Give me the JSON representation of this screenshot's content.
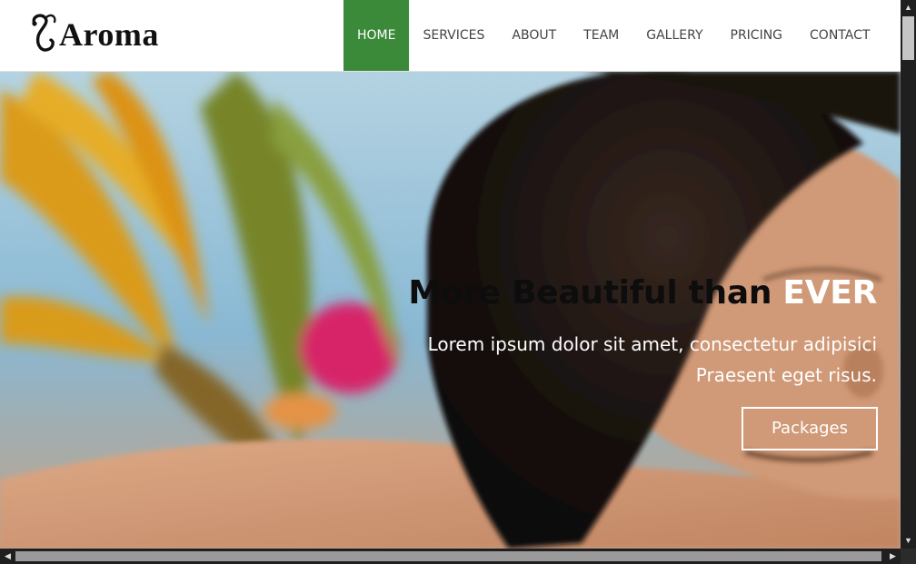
{
  "brand": {
    "name": "Aroma",
    "icon": "ornate-letter-icon"
  },
  "nav": {
    "items": [
      {
        "label": "HOME",
        "active": true
      },
      {
        "label": "SERVICES",
        "active": false
      },
      {
        "label": "ABOUT",
        "active": false
      },
      {
        "label": "TEAM",
        "active": false
      },
      {
        "label": "GALLERY",
        "active": false
      },
      {
        "label": "PRICING",
        "active": false
      },
      {
        "label": "CONTACT",
        "active": false
      }
    ]
  },
  "hero": {
    "title_main": "More Beautiful than ",
    "title_accent": "EVER",
    "text_line1": "Lorem ipsum dolor sit amet, consectetur adipisici",
    "text_line2": "Praesent eget risus.",
    "button_label": "Packages"
  },
  "scrollbars": {
    "up_icon": "scroll-up-arrow-icon",
    "down_icon": "scroll-down-arrow-icon",
    "left_icon": "scroll-left-arrow-icon",
    "right_icon": "scroll-right-arrow-icon"
  },
  "colors": {
    "nav_active_bg": "#3b8a3a",
    "header_bg": "#ffffff",
    "hero_title": "#0d0d0d",
    "hero_accent": "#ffffff"
  }
}
